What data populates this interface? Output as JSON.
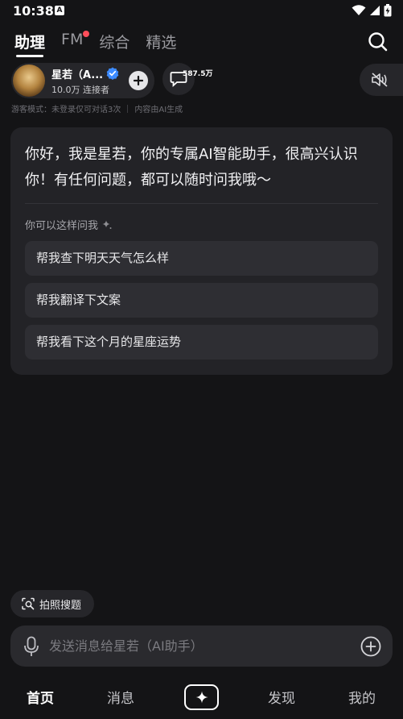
{
  "status_bar": {
    "time": "10:38",
    "app_indicator": "A"
  },
  "top_tabs": [
    {
      "label": "助理",
      "active": true,
      "dot": false
    },
    {
      "label": "FM",
      "active": false,
      "dot": true
    },
    {
      "label": "综合",
      "active": false,
      "dot": false
    },
    {
      "label": "精选",
      "active": false,
      "dot": false
    }
  ],
  "agent": {
    "name": "星若（A...",
    "connections": "10.0万 连接者",
    "verified": true
  },
  "comments": {
    "count": "587.5万"
  },
  "notice": {
    "guest_mode": "游客模式：未登录仅可对话3次",
    "ai_notice": "内容由AI生成"
  },
  "chat": {
    "greeting": "你好，我是星若，你的专属AI智能助手，很高兴认识你！有任何问题，都可以随时问我哦～",
    "suggest_title": "你可以这样问我",
    "suggestions": [
      "帮我查下明天天气怎么样",
      "帮我翻译下文案",
      "帮我看下这个月的星座运势"
    ]
  },
  "photo_search": {
    "label": "拍照搜题"
  },
  "input": {
    "placeholder": "发送消息给星若（AI助手）",
    "value": ""
  },
  "bottom_nav": {
    "home": "首页",
    "messages": "消息",
    "discover": "发现",
    "mine": "我的"
  },
  "colors": {
    "background": "#141416",
    "card": "#232327",
    "suggestion": "#2e2e33",
    "notification_dot": "#ff4d5a",
    "verified_badge": "#3d8bff"
  },
  "icons": {
    "status": [
      "wifi-icon",
      "signal-icon",
      "battery-icon"
    ],
    "search": "search-icon",
    "mute": "speaker-muted-icon",
    "comment": "comment-icon",
    "add": "plus-icon",
    "mic": "microphone-icon",
    "attach": "plus-circle-icon",
    "photo": "photo-search-icon",
    "center_nav": "sparkle-icon"
  }
}
